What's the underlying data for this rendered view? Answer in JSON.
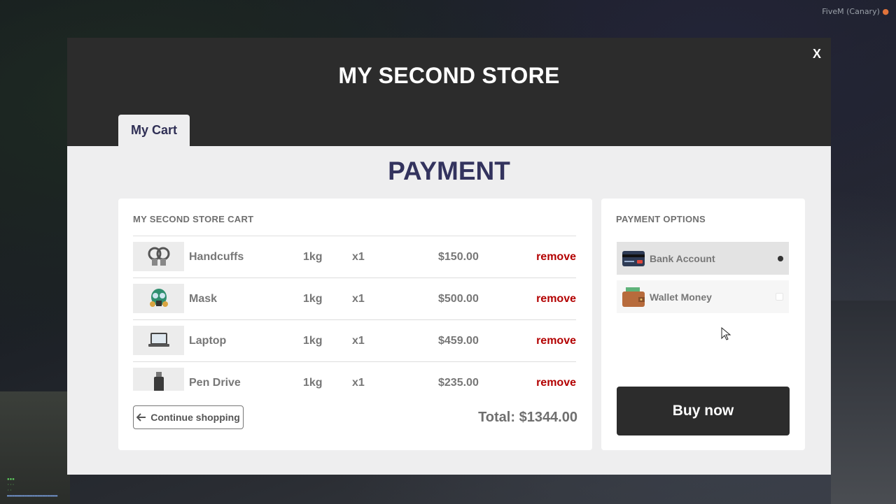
{
  "hud": {
    "text": "FiveM (Canary)"
  },
  "modal": {
    "close_label": "X",
    "store_title": "MY SECOND STORE",
    "tab_label": "My Cart",
    "payment_title": "PAYMENT"
  },
  "cart": {
    "title": "MY SECOND STORE CART",
    "items": [
      {
        "name": "Handcuffs",
        "weight": "1kg",
        "qty": "x1",
        "price": "$150.00",
        "remove": "remove",
        "icon": "handcuffs-icon"
      },
      {
        "name": "Mask",
        "weight": "1kg",
        "qty": "x1",
        "price": "$500.00",
        "remove": "remove",
        "icon": "gas-mask-icon"
      },
      {
        "name": "Laptop",
        "weight": "1kg",
        "qty": "x1",
        "price": "$459.00",
        "remove": "remove",
        "icon": "laptop-icon"
      },
      {
        "name": "Pen Drive",
        "weight": "1kg",
        "qty": "x1",
        "price": "$235.00",
        "remove": "remove",
        "icon": "pen-drive-icon"
      }
    ],
    "continue_label": "Continue shopping",
    "total": "Total: $1344.00"
  },
  "payment": {
    "title": "PAYMENT OPTIONS",
    "options": [
      {
        "label": "Bank Account",
        "selected": true,
        "icon": "credit-card-icon"
      },
      {
        "label": "Wallet Money",
        "selected": false,
        "icon": "wallet-icon"
      }
    ],
    "buy_label": "Buy now"
  },
  "colors": {
    "header": "#2c2c2c",
    "accent": "#33335e",
    "remove": "#b30000",
    "panel": "#eeeeef"
  }
}
